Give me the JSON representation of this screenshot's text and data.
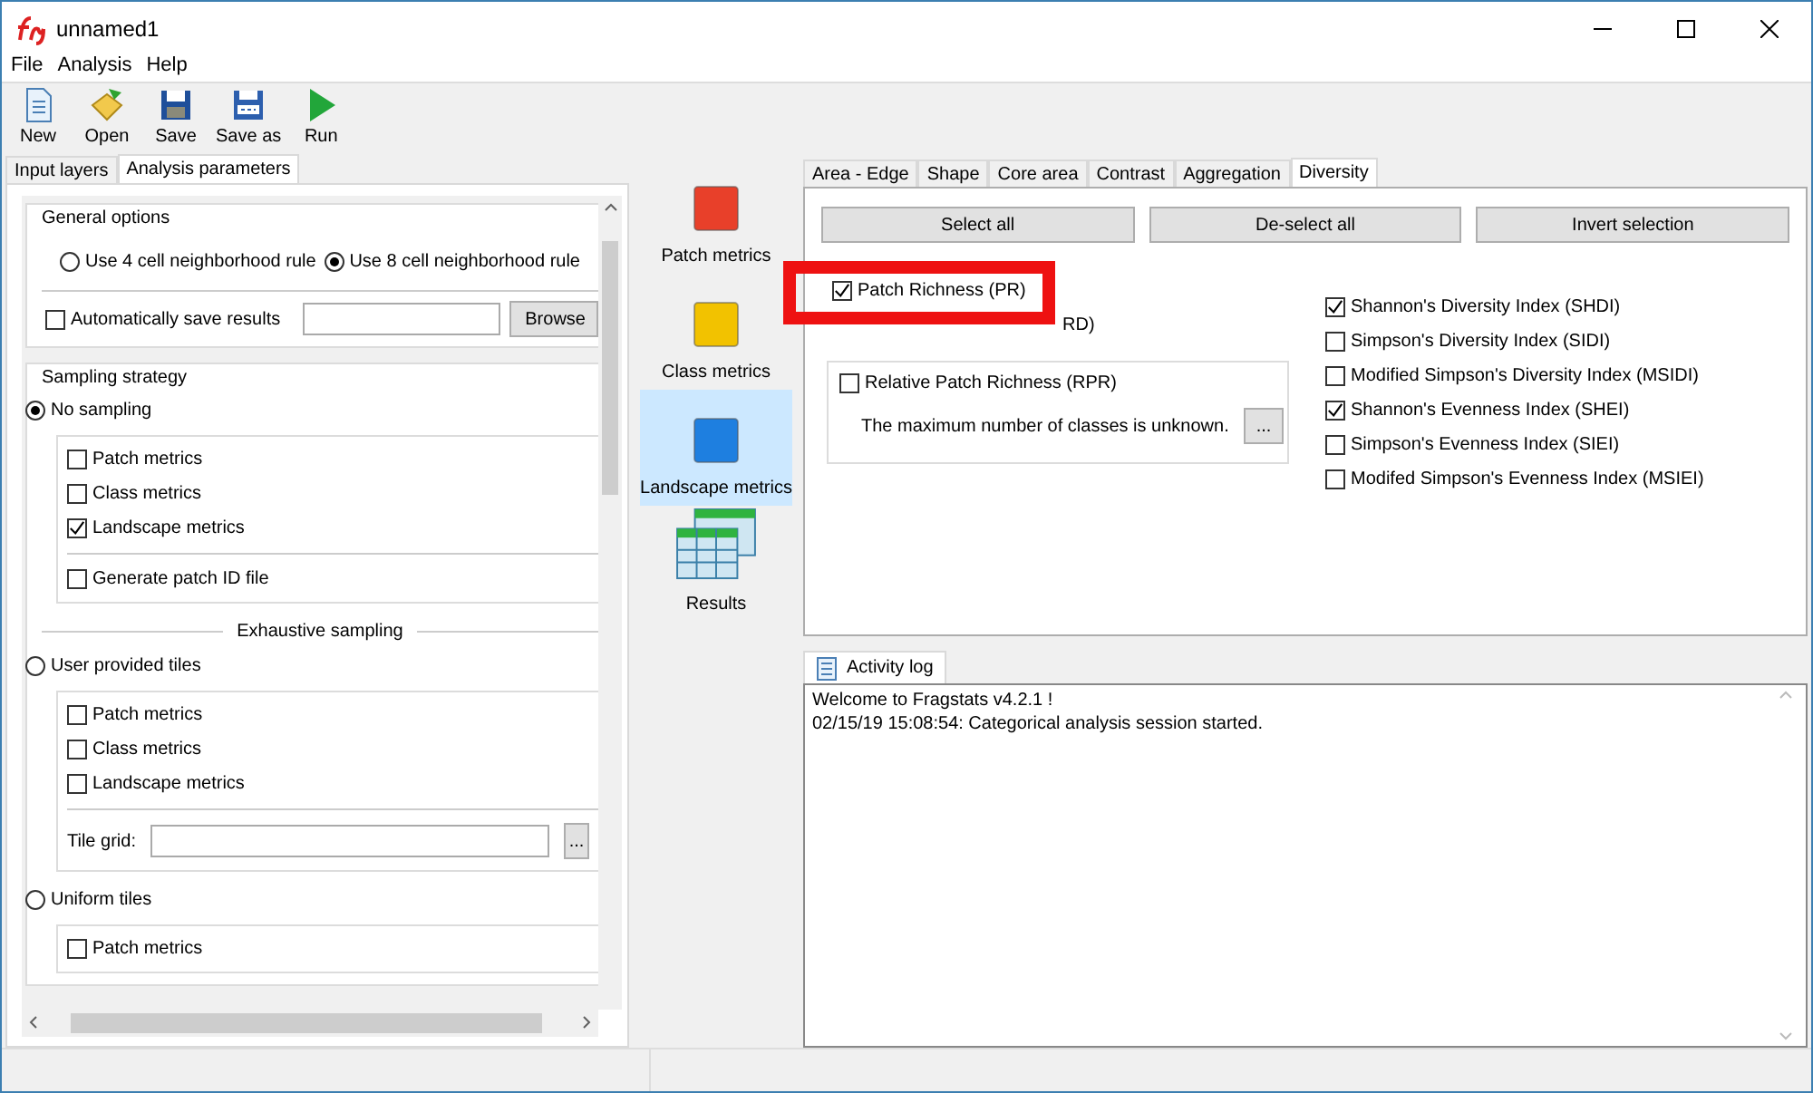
{
  "window": {
    "title": "unnamed1"
  },
  "menu": [
    "File",
    "Analysis",
    "Help"
  ],
  "toolbar": [
    {
      "label": "New",
      "kind": "new"
    },
    {
      "label": "Open",
      "kind": "open"
    },
    {
      "label": "Save",
      "kind": "save"
    },
    {
      "label": "Save as",
      "kind": "saveas"
    },
    {
      "label": "Run",
      "kind": "run"
    }
  ],
  "left_tabs": [
    {
      "label": "Input layers",
      "selected": false
    },
    {
      "label": "Analysis parameters",
      "selected": true
    }
  ],
  "general_options": {
    "title": "General options",
    "radios": [
      {
        "label": "Use 4 cell neighborhood rule",
        "selected": false
      },
      {
        "label": "Use 8 cell neighborhood rule",
        "selected": true
      }
    ],
    "autosave": {
      "label": "Automatically save results",
      "checked": false
    },
    "browse_button": "Browse"
  },
  "sampling": {
    "title": "Sampling strategy",
    "options": [
      {
        "label": "No sampling",
        "selected": true,
        "metrics": [
          {
            "label": "Patch metrics",
            "checked": false
          },
          {
            "label": "Class metrics",
            "checked": false
          },
          {
            "label": "Landscape metrics",
            "checked": true
          }
        ],
        "patch_id": {
          "label": "Generate patch ID file",
          "checked": false
        }
      },
      {
        "label": "User provided tiles",
        "selected": false,
        "heading": "Exhaustive sampling",
        "metrics": [
          {
            "label": "Patch metrics",
            "checked": false
          },
          {
            "label": "Class metrics",
            "checked": false
          },
          {
            "label": "Landscape metrics",
            "checked": false
          }
        ],
        "tile_grid": {
          "label": "Tile grid:",
          "button": "..."
        }
      },
      {
        "label": "Uniform tiles",
        "selected": false,
        "metrics": [
          {
            "label": "Patch metrics",
            "checked": false
          }
        ]
      }
    ]
  },
  "metric_levels": [
    {
      "label": "Patch metrics",
      "kind": "square",
      "color": "#e8402a",
      "selected": false
    },
    {
      "label": "Class metrics",
      "kind": "square",
      "color": "#f2c200",
      "selected": false
    },
    {
      "label": "Landscape metrics",
      "kind": "square",
      "color": "#1e7fe0",
      "selected": true
    },
    {
      "label": "Results",
      "kind": "table",
      "selected": false
    }
  ],
  "metric_tabs": [
    {
      "label": "Area - Edge",
      "selected": false
    },
    {
      "label": "Shape",
      "selected": false
    },
    {
      "label": "Core area",
      "selected": false
    },
    {
      "label": "Contrast",
      "selected": false
    },
    {
      "label": "Aggregation",
      "selected": false
    },
    {
      "label": "Diversity",
      "selected": true
    }
  ],
  "selection_buttons": [
    "Select all",
    "De-select all",
    "Invert selection"
  ],
  "richness": [
    {
      "label": "Patch Richness  (PR)",
      "checked": true
    },
    {
      "label": "RD)",
      "covered": true
    }
  ],
  "relative_richness": {
    "label": "Relative Patch Richness  (RPR)",
    "checked": false,
    "note": "The maximum number of classes is unknown.",
    "button": "..."
  },
  "diversity": [
    {
      "label": "Shannon's Diversity Index   (SHDI)",
      "checked": true
    },
    {
      "label": "Simpson's Diversity Index  (SIDI)",
      "checked": false
    },
    {
      "label": "Modified Simpson's Diversity Index  (MSIDI)",
      "checked": false
    },
    {
      "label": "Shannon's Evenness Index  (SHEI)",
      "checked": true
    },
    {
      "label": "Simpson's Evenness Index  (SIEI)",
      "checked": false
    },
    {
      "label": "Modifed Simpson's Evenness Index  (MSIEI)",
      "checked": false
    }
  ],
  "activity_log": {
    "tab": "Activity log",
    "lines": [
      "Welcome to Fragstats v4.2.1 !",
      "02/15/19 15:08:54: Categorical analysis session started."
    ]
  }
}
